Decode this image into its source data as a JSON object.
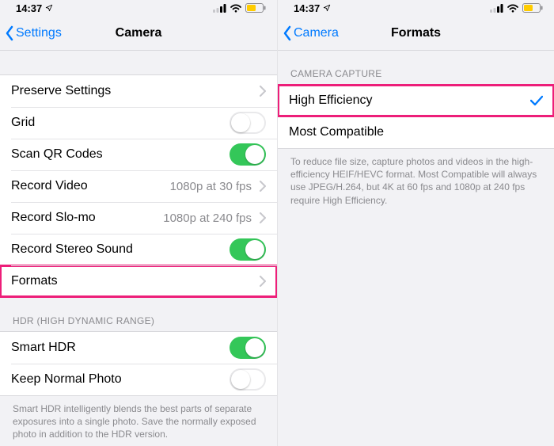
{
  "left": {
    "status": {
      "time": "14:37",
      "location_icon": true
    },
    "nav": {
      "back": "Settings",
      "title": "Camera"
    },
    "group1": {
      "preserve": "Preserve Settings",
      "grid": "Grid",
      "qr": "Scan QR Codes",
      "record_video": {
        "label": "Record Video",
        "value": "1080p at 30 fps"
      },
      "record_slomo": {
        "label": "Record Slo-mo",
        "value": "1080p at 240 fps"
      },
      "stereo": "Record Stereo Sound",
      "formats": "Formats",
      "toggles": {
        "grid": false,
        "qr": true,
        "stereo": true
      }
    },
    "hdr": {
      "header": "HDR (HIGH DYNAMIC RANGE)",
      "smart": "Smart HDR",
      "keep": "Keep Normal Photo",
      "toggles": {
        "smart": true,
        "keep": false
      },
      "footer": "Smart HDR intelligently blends the best parts of separate exposures into a single photo. Save the normally exposed photo in addition to the HDR version."
    }
  },
  "right": {
    "status": {
      "time": "14:37",
      "location_icon": true
    },
    "nav": {
      "back": "Camera",
      "title": "Formats"
    },
    "capture": {
      "header": "CAMERA CAPTURE",
      "opt1": "High Efficiency",
      "opt2": "Most Compatible",
      "selected": "opt1",
      "footer": "To reduce file size, capture photos and videos in the high-efficiency HEIF/HEVC format. Most Compatible will always use JPEG/H.264, but 4K at 60 fps and 1080p at 240 fps require High Efficiency."
    }
  }
}
